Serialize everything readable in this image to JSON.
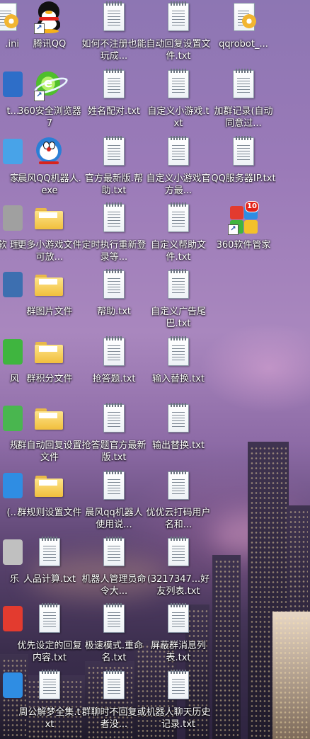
{
  "columns": [
    {
      "id": "c0",
      "items": [
        {
          "label": ".ini",
          "icon": "ini-file-icon",
          "color": "#3a7bd5"
        },
        {
          "label": "t...",
          "icon": "app-icon",
          "color": "#2e6ec8"
        },
        {
          "label": "家",
          "icon": "app-icon",
          "color": "#48a3e8"
        },
        {
          "label": "-软\n理",
          "icon": "app-icon",
          "color": "#a0a0a0"
        },
        {
          "label": "",
          "icon": "app-icon",
          "color": "#3d6fb0"
        },
        {
          "label": "风",
          "icon": "app-icon",
          "color": "#3fb53f"
        },
        {
          "label": "规",
          "icon": "app-icon",
          "color": "#49b64f"
        },
        {
          "label": "(...",
          "icon": "app-icon",
          "color": "#2f8de3"
        },
        {
          "label": "乐",
          "icon": "app-icon",
          "color": "#c0c0c0"
        },
        {
          "label": "",
          "icon": "app-icon",
          "color": "#e33b2f"
        },
        {
          "label": "",
          "icon": "app-icon",
          "color": "#2f8de3"
        }
      ]
    },
    {
      "id": "c1",
      "items": [
        {
          "label": "腾讯QQ",
          "icon": "qq-penguin-icon"
        },
        {
          "label": "360安全浏览器7",
          "icon": "360-browser-icon"
        },
        {
          "label": "晨风QQ机器人.exe",
          "icon": "doraemon-icon"
        },
        {
          "label": "更多小游戏文件可放...",
          "icon": "folder-icon"
        },
        {
          "label": "群图片文件",
          "icon": "folder-icon"
        },
        {
          "label": "群积分文件",
          "icon": "folder-icon"
        },
        {
          "label": "群自动回复设置文件",
          "icon": "folder-icon"
        },
        {
          "label": "群规则设置文件",
          "icon": "folder-icon"
        },
        {
          "label": "人品计算.txt",
          "icon": "txt-file-icon"
        },
        {
          "label": "优先设定的回复内容.txt",
          "icon": "txt-file-icon"
        },
        {
          "label": "周公解梦全集.txt",
          "icon": "txt-file-icon"
        }
      ]
    },
    {
      "id": "c2",
      "items": [
        {
          "label": "如何不注册也能玩成...",
          "icon": "txt-file-icon"
        },
        {
          "label": "姓名配对.txt",
          "icon": "txt-file-icon"
        },
        {
          "label": "官方最新版.帮助.txt",
          "icon": "txt-file-icon"
        },
        {
          "label": "定时执行重新登录等...",
          "icon": "txt-file-icon"
        },
        {
          "label": "帮助.txt",
          "icon": "txt-file-icon"
        },
        {
          "label": "抢答题.txt",
          "icon": "txt-file-icon"
        },
        {
          "label": "抢答题官方最新版.txt",
          "icon": "txt-file-icon"
        },
        {
          "label": "晨风qq机器人使用说...",
          "icon": "txt-file-icon"
        },
        {
          "label": "机器人管理员命令大...",
          "icon": "txt-file-icon"
        },
        {
          "label": "极速模式.重命名.txt",
          "icon": "txt-file-icon"
        },
        {
          "label": "群聊时不回复或者没...",
          "icon": "txt-file-icon"
        }
      ]
    },
    {
      "id": "c3",
      "items": [
        {
          "label": "自动回复设置文件.txt",
          "icon": "txt-file-icon"
        },
        {
          "label": "自定义小游戏.txt",
          "icon": "txt-file-icon"
        },
        {
          "label": "自定义小游戏官方最...",
          "icon": "txt-file-icon"
        },
        {
          "label": "自定义帮助文件.txt",
          "icon": "txt-file-icon"
        },
        {
          "label": "自定义广告尾巴.txt",
          "icon": "txt-file-icon"
        },
        {
          "label": "输入替换.txt",
          "icon": "txt-file-icon"
        },
        {
          "label": "输出替换.txt",
          "icon": "txt-file-icon"
        },
        {
          "label": "优优云打码用户名和...",
          "icon": "txt-file-icon"
        },
        {
          "label": "(3217347...好友列表.txt",
          "icon": "txt-file-icon"
        },
        {
          "label": "屏蔽群消息列表.txt",
          "icon": "txt-file-icon"
        },
        {
          "label": "机器人聊天历史记录.txt",
          "icon": "txt-file-icon"
        }
      ]
    },
    {
      "id": "c4",
      "items": [
        {
          "label": "qqrobot_...",
          "icon": "ini-file-icon"
        },
        {
          "label": "加群记录(自动同意过...",
          "icon": "txt-file-icon"
        },
        {
          "label": "QQ服务器IP.txt",
          "icon": "txt-file-icon"
        },
        {
          "label": "360软件管家",
          "icon": "360-soft-manager-icon",
          "badge": "10"
        }
      ]
    }
  ]
}
